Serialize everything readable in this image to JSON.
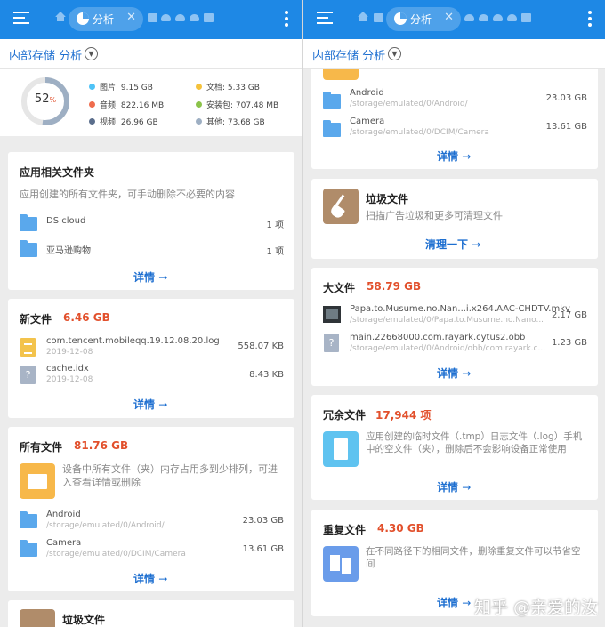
{
  "app": {
    "tab_label": "分析",
    "header_title": "内部存储 分析"
  },
  "colors": {
    "toolbar": "#1e88e5",
    "accent": "#1e6fd0",
    "highlight": "#e2502c",
    "folder": "#5aa8ec"
  },
  "storage": {
    "percent_value": "52",
    "percent_sign": "%",
    "used_fraction": 0.52,
    "legend": [
      {
        "label": "图片: 9.15 GB",
        "color": "#4fc3f7"
      },
      {
        "label": "文档: 5.33 GB",
        "color": "#f5c23c"
      },
      {
        "label": "音频: 822.16 MB",
        "color": "#ef6c4d"
      },
      {
        "label": "安装包: 707.48 MB",
        "color": "#8bc34a"
      },
      {
        "label": "视频: 26.96 GB",
        "color": "#5b6e8c"
      },
      {
        "label": "其他: 73.68 GB",
        "color": "#9eafc3"
      }
    ]
  },
  "app_folders": {
    "title": "应用相关文件夹",
    "desc": "应用创建的所有文件夹，可手动删除不必要的内容",
    "items": [
      {
        "name": "DS cloud",
        "count": "1 项"
      },
      {
        "name": "亚马逊购物",
        "count": "1 项"
      }
    ],
    "more": "详情"
  },
  "new_files": {
    "title": "新文件",
    "value": "6.46 GB",
    "items": [
      {
        "name": "com.tencent.mobileqq.19.12.08.20.log",
        "date": "2019-12-08",
        "size": "558.07 KB",
        "icon": "text-file-icon"
      },
      {
        "name": "cache.idx",
        "date": "2019-12-08",
        "size": "8.43 KB",
        "icon": "unknown-file-icon"
      }
    ],
    "more": "详情"
  },
  "all_files": {
    "title": "所有文件",
    "value": "81.76 GB",
    "desc": "设备中所有文件（夹）内存占用多到少排列，可进入查看详情或删除",
    "items": [
      {
        "name": "Android",
        "path": "/storage/emulated/0/Android/",
        "size": "23.03 GB"
      },
      {
        "name": "Camera",
        "path": "/storage/emulated/0/DCIM/Camera",
        "size": "13.61 GB"
      }
    ],
    "more": "详情"
  },
  "junk": {
    "title": "垃圾文件",
    "desc": "扫描广告垃圾和更多可清理文件",
    "action": "清理一下"
  },
  "large_files": {
    "title": "大文件",
    "value": "58.79 GB",
    "items": [
      {
        "name": "Papa.to.Musume.no.Nan...i.x264.AAC-CHDTV.mkv",
        "path": "/storage/emulated/0/Papa.to.Musume.no.Nano...",
        "size": "2.17 GB"
      },
      {
        "name": "main.22668000.com.rayark.cytus2.obb",
        "path": "/storage/emulated/0/Android/obb/com.rayark.c...",
        "size": "1.23 GB"
      }
    ],
    "more": "详情"
  },
  "redundant": {
    "title": "冗余文件",
    "value": "17,944 项",
    "desc": "应用创建的临时文件（.tmp）日志文件（.log）手机中的空文件（夹），删除后不会影响设备正常使用",
    "more": "详情"
  },
  "duplicate": {
    "title": "重复文件",
    "value": "4.30 GB",
    "desc": "在不同路径下的相同文件，删除重复文件可以节省空间",
    "more": "详情"
  },
  "watermark": "知乎 @亲爱的汝"
}
